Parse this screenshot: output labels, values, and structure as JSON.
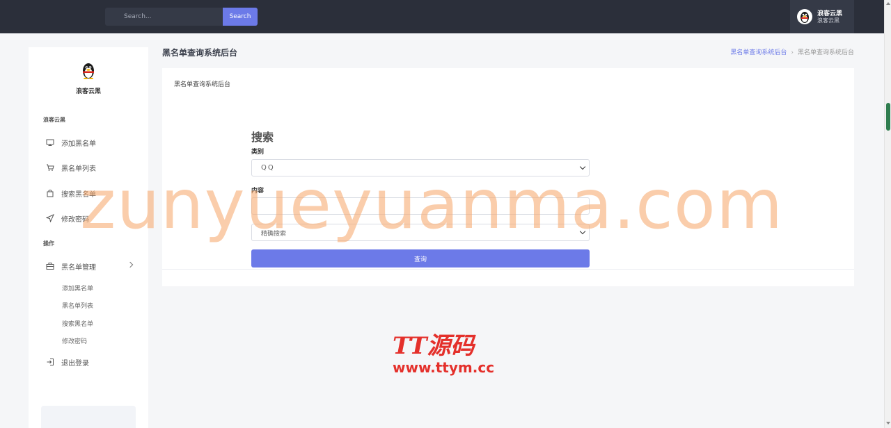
{
  "topbar": {
    "search_placeholder": "Search...",
    "search_button": "Search",
    "user_name": "浪客云黑",
    "user_sub": "浪客云黑"
  },
  "sidebar": {
    "username": "浪客云黑",
    "section1": "浪客云黑",
    "items": [
      {
        "label": "添加黑名单",
        "icon": "monitor-icon"
      },
      {
        "label": "黑名单列表",
        "icon": "cart-icon"
      },
      {
        "label": "搜索黑名单",
        "icon": "bag-icon"
      },
      {
        "label": "修改密码",
        "icon": "send-icon"
      }
    ],
    "section2": "操作",
    "manage": {
      "label": "黑名单管理",
      "icon": "briefcase-icon"
    },
    "subitems": [
      "添加黑名单",
      "黑名单列表",
      "搜索黑名单",
      "修改密码"
    ],
    "logout": {
      "label": "退出登录",
      "icon": "logout-icon"
    }
  },
  "main": {
    "page_title": "黑名单查询系统后台",
    "breadcrumb": [
      "黑名单查询系统后台",
      "黑名单查询系统后台"
    ],
    "card_title": "黑名单查询系统后台",
    "form": {
      "heading": "搜索",
      "category_label": "类别",
      "category_value": "QQ",
      "content_label": "内容",
      "content_value": "",
      "mode_value": "精确搜索",
      "submit_label": "查询"
    }
  },
  "watermarks": {
    "big": "zunyueyuanma.com",
    "logo_top": "TT源码",
    "logo_bottom": "www.ttym.cc"
  },
  "colors": {
    "topbar": "#2b2f3a",
    "accent": "#6c7ae8",
    "watermark": "#f7a86e",
    "logo_red": "#e4302b"
  }
}
